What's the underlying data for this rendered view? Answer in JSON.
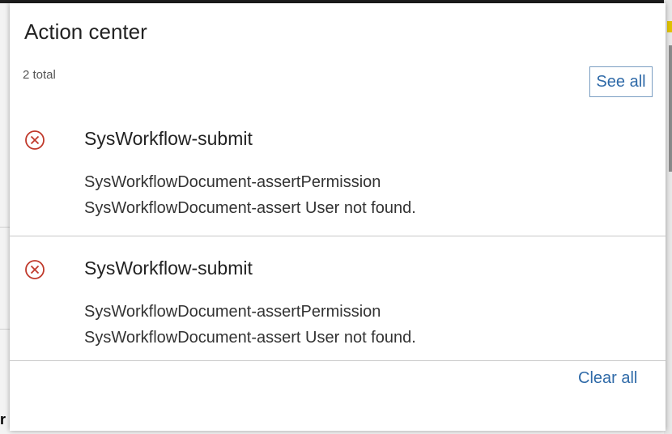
{
  "panel": {
    "title": "Action center",
    "total": "2 total",
    "see_all": "See all",
    "clear_all": "Clear all"
  },
  "notifications": [
    {
      "title": "SysWorkflow-submit",
      "line1": "SysWorkflowDocument-assertPermission",
      "line2": "SysWorkflowDocument-assert User not found.",
      "icon": "error-circle-icon"
    },
    {
      "title": "SysWorkflow-submit",
      "line1": "SysWorkflowDocument-assertPermission",
      "line2": "SysWorkflowDocument-assert User not found.",
      "icon": "error-circle-icon"
    }
  ],
  "background": {
    "left_fragment": "r"
  },
  "colors": {
    "error": "#c0392b",
    "link": "#2f6aa8"
  }
}
